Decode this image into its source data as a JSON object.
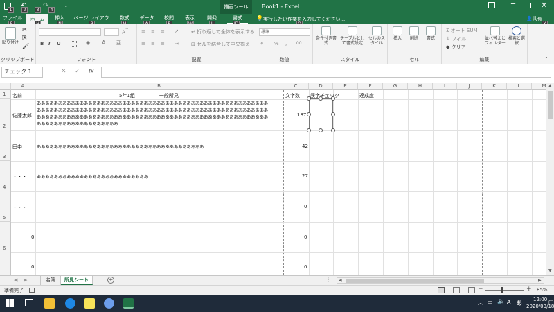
{
  "title_bar": {
    "context_tool": "描画ツール",
    "title": "Book1 - Excel"
  },
  "tabs": [
    {
      "label": "ファイル",
      "key": "F"
    },
    {
      "label": "ホーム",
      "key": "H"
    },
    {
      "label": "挿入",
      "key": "N"
    },
    {
      "label": "ページ レイアウト",
      "key": "P"
    },
    {
      "label": "数式",
      "key": "M"
    },
    {
      "label": "データ",
      "key": "A"
    },
    {
      "label": "校閲",
      "key": "R"
    },
    {
      "label": "表示",
      "key": "W"
    },
    {
      "label": "開発",
      "key": "L"
    },
    {
      "label": "書式",
      "key": "JD"
    }
  ],
  "tell_me": {
    "placeholder": "実行したい作業を入力してください...",
    "key": "Q"
  },
  "share": {
    "label": "共有",
    "key": "Y"
  },
  "qat_keys": [
    "1",
    "2",
    "3",
    "4"
  ],
  "ribbon": {
    "clipboard": {
      "label": "クリップボード",
      "paste": "貼り付け"
    },
    "font": {
      "label": "フォント"
    },
    "alignment": {
      "label": "配置",
      "wrap": "折り返して全体を表示する",
      "merge": "セルを結合して中央揃え"
    },
    "number": {
      "label": "数値",
      "format": "標準"
    },
    "styles": {
      "label": "スタイル",
      "cond": "条件付き書式",
      "table": "テーブルとして書式設定",
      "cell": "セルのスタイル"
    },
    "cells": {
      "label": "セル",
      "insert": "挿入",
      "delete": "削除",
      "format": "書式"
    },
    "editing": {
      "label": "編集",
      "autosum": "オート SUM",
      "fill": "フィル",
      "clear": "クリア",
      "sort": "並べ替えとフィルター",
      "find": "検索と選択"
    }
  },
  "formula_bar": {
    "name_box": "チェック 1"
  },
  "columns": [
    "A",
    "B",
    "C",
    "D",
    "E",
    "F",
    "G",
    "H",
    "I",
    "J",
    "K",
    "L",
    "M"
  ],
  "rows": [
    "1",
    "2",
    "3",
    "4",
    "5",
    "6",
    "7"
  ],
  "cells": {
    "a1": "名前",
    "b1": "5年1組　　　　　一般所見",
    "c1": "文字数",
    "d1": "誤字チェック",
    "f1": "達成度",
    "a2": "佐藤太郎",
    "b2_lines": [
      "ああああああああああああああああああああああああああああああああああああああああああああああああああああああ",
      "ああああああああああああああああああああああああああああああああああああああああああああああああああああああ",
      "ああああああああああああああああああああああああああああああああああああああああああああああああああああああ",
      "あああああああああああああああああああ"
    ],
    "c2": "187",
    "a3": "田中",
    "b3": "あああああああああああああああああああああああああああああああああああああああ",
    "c3": "42",
    "a4": "・・・",
    "b4": "ああああああああああああああああああああああああああ",
    "c4": "27",
    "a5": "・・・",
    "c5": "0",
    "a6": "0",
    "c6": "0",
    "a7": "0",
    "c7": "0"
  },
  "sheet_tabs": [
    "名簿",
    "所見シート"
  ],
  "status": {
    "ready": "準備完了",
    "zoom": "85%"
  },
  "taskbar": {
    "time": "12:00",
    "date": "2020/03/18",
    "ime": "あ"
  }
}
